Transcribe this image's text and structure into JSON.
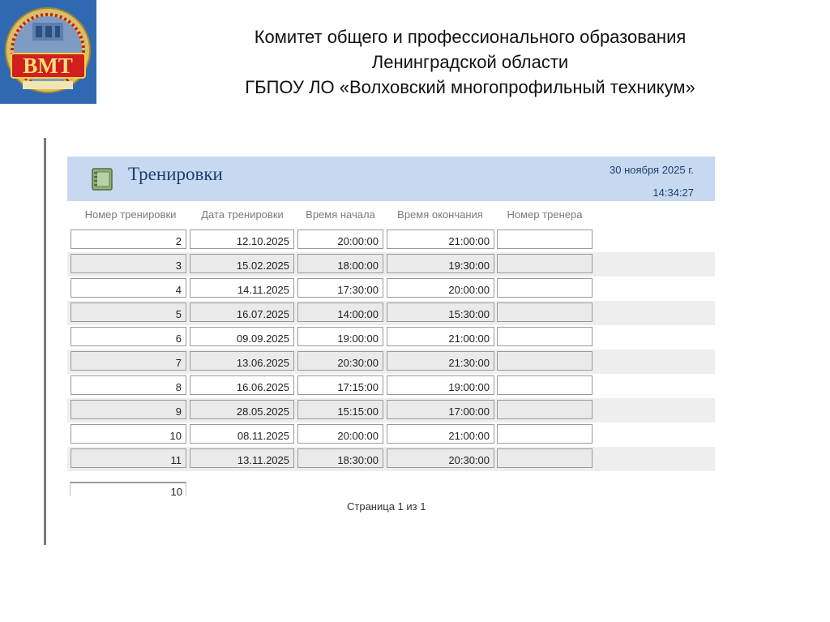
{
  "header": {
    "lines": [
      "Комитет общего и профессионального образования",
      "Ленинградской области",
      "ГБПОУ ЛО  «Волховский многопрофильный техникум»"
    ],
    "logo_text": "ВМТ"
  },
  "report": {
    "title": "Тренировки",
    "date": "30 ноября 2025 г.",
    "time": "14:34:27",
    "columns": [
      "Номер тренировки",
      "Дата тренировки",
      "Время начала",
      "Время окончания",
      "Номер тренера"
    ],
    "rows": [
      [
        "2",
        "12.10.2025",
        "20:00:00",
        "21:00:00",
        ""
      ],
      [
        "3",
        "15.02.2025",
        "18:00:00",
        "19:30:00",
        ""
      ],
      [
        "4",
        "14.11.2025",
        "17:30:00",
        "20:00:00",
        ""
      ],
      [
        "5",
        "16.07.2025",
        "14:00:00",
        "15:30:00",
        ""
      ],
      [
        "6",
        "09.09.2025",
        "19:00:00",
        "21:00:00",
        ""
      ],
      [
        "7",
        "13.06.2025",
        "20:30:00",
        "21:30:00",
        ""
      ],
      [
        "8",
        "16.06.2025",
        "17:15:00",
        "19:00:00",
        ""
      ],
      [
        "9",
        "28.05.2025",
        "15:15:00",
        "17:00:00",
        ""
      ],
      [
        "10",
        "08.11.2025",
        "20:00:00",
        "21:00:00",
        ""
      ],
      [
        "11",
        "13.11.2025",
        "18:30:00",
        "20:30:00",
        ""
      ]
    ],
    "count": "10",
    "page_label": "Страница 1 из 1"
  },
  "colors": {
    "band": "#c6d9f1",
    "title": "#1f3f6b",
    "logo_bg": "#2f69b1"
  },
  "icons": {
    "report": "report-notebook-icon"
  }
}
